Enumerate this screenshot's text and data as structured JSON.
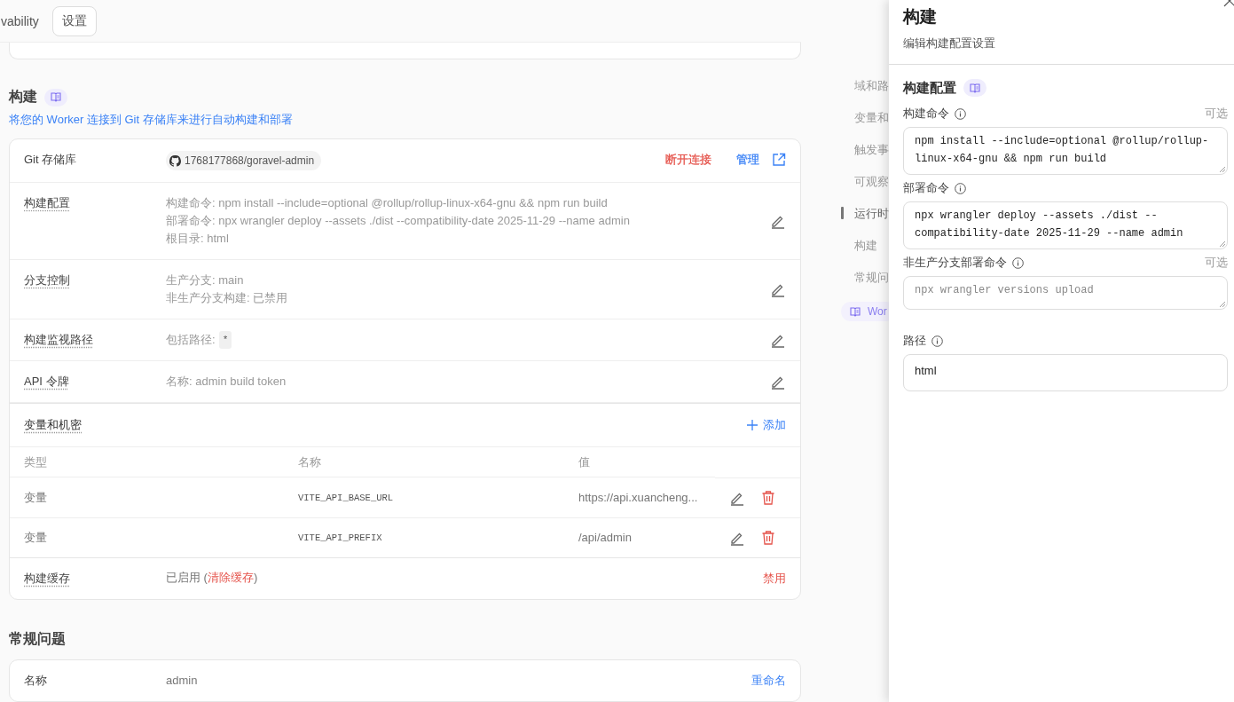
{
  "tabs": [
    {
      "label": "vability",
      "selected": false
    },
    {
      "label": "设置",
      "selected": true
    }
  ],
  "build": {
    "title": "构建",
    "subtitle": "将您的 Worker 连接到 Git 存储库来进行自动构建和部署",
    "rows": [
      {
        "kind": "repo",
        "label": "Git 存储库",
        "repo": "1768177868/goravel-admin",
        "actions": [
          {
            "text": "断开连接",
            "kind": "disconnect",
            "color": "#e5534b"
          },
          {
            "text": "管理",
            "kind": "manage",
            "color": "#3b82f6"
          }
        ]
      },
      {
        "kind": "lines",
        "label": "构建配置",
        "lines": [
          "构建命令: npm install --include=optional @rollup/rollup-linux-x64-gnu && npm run build",
          "部署命令: npx wrangler deploy --assets ./dist --compatibility-date 2025-11-29 --name admin",
          "根目录: html"
        ]
      },
      {
        "kind": "lines",
        "label": "分支控制",
        "lines": [
          "生产分支: main",
          "非生产分支构建: 已禁用"
        ]
      },
      {
        "kind": "path",
        "label": "构建监视路径",
        "text": "包括路径:",
        "code": "*"
      },
      {
        "kind": "lines",
        "label": "API 令牌",
        "lines": [
          "名称: admin build token"
        ]
      },
      {
        "kind": "vars",
        "label": "变量和机密",
        "add": "添加",
        "columns": [
          "类型",
          "名称",
          "值"
        ],
        "rows": [
          {
            "type": "变量",
            "name": "VITE_API_BASE_URL",
            "value": "https://api.xuancheng..."
          },
          {
            "type": "变量",
            "name": "VITE_API_PREFIX",
            "value": "/api/admin"
          }
        ]
      },
      {
        "kind": "cache",
        "label": "构建缓存",
        "status": "已启用 (",
        "link": "清除缓存",
        "close": ")",
        "action": "禁用"
      }
    ]
  },
  "general": {
    "title": "常规问题",
    "rows": [
      {
        "label": "名称",
        "value": "admin",
        "action": "重命名"
      }
    ]
  },
  "nav": [
    {
      "label": "域和路",
      "selected": false
    },
    {
      "label": "变量和",
      "selected": false
    },
    {
      "label": "触发事",
      "selected": false
    },
    {
      "label": "可观察",
      "selected": false
    },
    {
      "label": "运行时",
      "selected": true
    },
    {
      "label": "构建",
      "selected": false
    },
    {
      "label": "常规问",
      "selected": false
    }
  ],
  "nav_link": "Wor",
  "panel": {
    "title": "构建",
    "subtitle": "编辑构建配置设置",
    "section": "构建配置",
    "fields": [
      {
        "kind": "textarea",
        "label": "构建命令",
        "optional": "可选",
        "value": "npm install --include=optional @rollup/rollup-linux-x64-gnu && npm run build"
      },
      {
        "kind": "textarea",
        "label": "部署命令",
        "value": "npx wrangler deploy --assets ./dist --compatibility-date 2025-11-29 --name admin"
      },
      {
        "kind": "textarea",
        "label": "非生产分支部署命令",
        "optional": "可选",
        "placeholder": "npx wrangler versions upload"
      },
      {
        "kind": "input",
        "label": "路径",
        "value": "html"
      }
    ]
  }
}
